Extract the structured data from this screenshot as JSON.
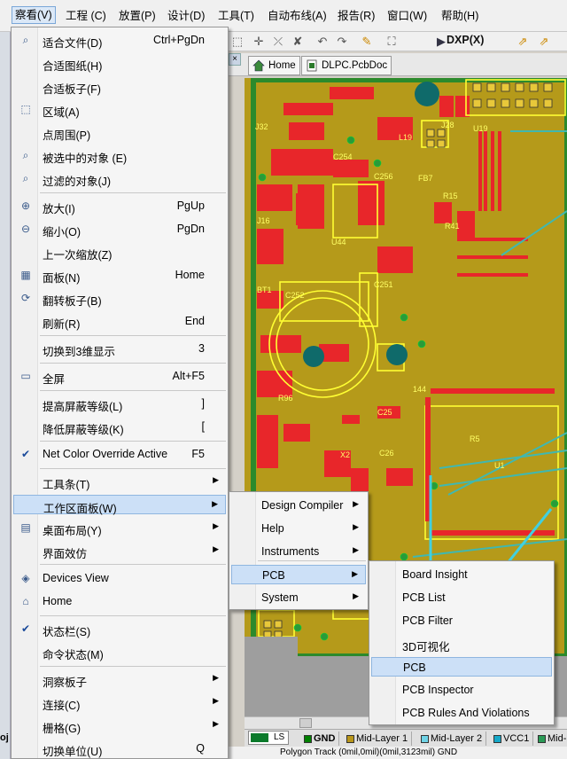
{
  "menubar": {
    "items": [
      "察看(V)",
      "工程 (C)",
      "放置(P)",
      "设计(D)",
      "工具(T)",
      "自动布线(A)",
      "报告(R)",
      "窗口(W)",
      "帮助(H)"
    ]
  },
  "toolbar": {
    "dxp_label": "DXP(X)"
  },
  "doc_tabs": {
    "home": "Home",
    "pcb": "DLPC.PcbDoc"
  },
  "view_menu": {
    "items": [
      {
        "label": "适合文件(D)",
        "shortcut": "Ctrl+PgDn"
      },
      {
        "label": "合适图纸(H)",
        "shortcut": ""
      },
      {
        "label": "合适板子(F)",
        "shortcut": ""
      },
      {
        "label": "区域(A)",
        "shortcut": ""
      },
      {
        "label": "点周围(P)",
        "shortcut": ""
      },
      {
        "label": "被选中的对象 (E)",
        "shortcut": ""
      },
      {
        "label": "过滤的对象(J)",
        "shortcut": ""
      },
      {
        "label": "放大(I)",
        "shortcut": "PgUp"
      },
      {
        "label": "缩小(O)",
        "shortcut": "PgDn"
      },
      {
        "label": "上一次缩放(Z)",
        "shortcut": ""
      },
      {
        "label": "面板(N)",
        "shortcut": "Home"
      },
      {
        "label": "翻转板子(B)",
        "shortcut": ""
      },
      {
        "label": "刷新(R)",
        "shortcut": "End"
      },
      {
        "label": "切换到3维显示",
        "shortcut": "3"
      },
      {
        "label": "全屏",
        "shortcut": "Alt+F5"
      },
      {
        "label": "提高屏蔽等级(L)",
        "shortcut": "]"
      },
      {
        "label": "降低屏蔽等级(K)",
        "shortcut": "["
      },
      {
        "label": "Net Color Override Active",
        "shortcut": "F5"
      },
      {
        "label": "工具条(T)",
        "shortcut": ""
      },
      {
        "label": "工作区面板(W)",
        "shortcut": ""
      },
      {
        "label": "桌面布局(Y)",
        "shortcut": ""
      },
      {
        "label": "界面效仿",
        "shortcut": ""
      },
      {
        "label": "Devices View",
        "shortcut": ""
      },
      {
        "label": "Home",
        "shortcut": ""
      },
      {
        "label": "状态栏(S)",
        "shortcut": ""
      },
      {
        "label": "命令状态(M)",
        "shortcut": ""
      },
      {
        "label": "洞察板子",
        "shortcut": ""
      },
      {
        "label": "连接(C)",
        "shortcut": ""
      },
      {
        "label": "栅格(G)",
        "shortcut": ""
      },
      {
        "label": "切换单位(U)",
        "shortcut": "Q"
      }
    ]
  },
  "workspace_menu": {
    "items": [
      "Design Compiler",
      "Help",
      "Instruments",
      "PCB",
      "System"
    ]
  },
  "pcb_menu": {
    "items": [
      "Board Insight",
      "PCB List",
      "PCB Filter",
      "3D可视化",
      "PCB",
      "PCB Inspector",
      "PCB Rules And Violations"
    ]
  },
  "layer_tabs": [
    "LS",
    "GND",
    "Mid-Layer 1",
    "Mid-Layer 2",
    "VCC1",
    "Mid-"
  ],
  "layer_colors": [
    "#0a7a2a",
    "#008000",
    "#b8961a",
    "#6fd3e6",
    "#15a8c8",
    "#2a9a55"
  ],
  "status": {
    "text": "Polygon Track (0mil,0mil)(0mil,3123mil)  GND"
  },
  "left_strip_text": "oj",
  "pcb_labels": [
    "J32",
    "C254",
    "C256",
    "FB7",
    "L19",
    "J28",
    "U19",
    "J16",
    "C252",
    "U44",
    "C251",
    "BT1",
    "R96",
    "C25",
    "X2",
    "C26",
    "144",
    "R15",
    "U1",
    "R41",
    "R5"
  ],
  "colors": {
    "accent": "#3399ff",
    "highlight": "#cce0f7",
    "pcb_copper": "#e8262a",
    "pcb_silk": "#ffff33",
    "pcb_bg": "#b59a1a",
    "arrow": "#40d0e0"
  }
}
